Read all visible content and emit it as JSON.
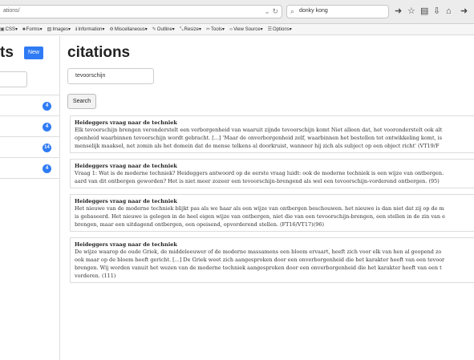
{
  "browser": {
    "url": "ations/",
    "search_text": "donky kong",
    "devbar": [
      {
        "icon": "▣",
        "label": "CSS▾"
      },
      {
        "icon": "■",
        "label": "Forms▾"
      },
      {
        "icon": "▧",
        "label": "Images▾"
      },
      {
        "icon": "ℹ",
        "label": "Information▾"
      },
      {
        "icon": "⚙",
        "label": "Miscellaneous▾"
      },
      {
        "icon": "✎",
        "label": "Outline▾"
      },
      {
        "icon": "⤡",
        "label": "Resize▾"
      },
      {
        "icon": "✂",
        "label": "Tools▾"
      },
      {
        "icon": "‹›",
        "label": "View Source▾"
      },
      {
        "icon": "☰",
        "label": "Options▾"
      }
    ]
  },
  "sidebar": {
    "title": "ts",
    "new_label": "New",
    "items": [
      {
        "count": "4"
      },
      {
        "count": "4"
      },
      {
        "count": "14"
      },
      {
        "count": "4"
      }
    ]
  },
  "main": {
    "title": "citations",
    "query": "tevoorschijn",
    "search_label": "Search"
  },
  "results": [
    {
      "heading": "Heideggers vraag naar de techniek",
      "lines": [
        "Elk tevoorschijn brengen veronderstelt een verborgenheid van waaruit zijnde tevoorschijn komt Niet alleen dat, het vooronderstelt ook alt",
        "openheid waarbinnen tevoorschijn wordt gebracht. [...] 'Maar de onverborgenheid zelf, waarbinnen het bestellen tot ontwikkeling komt, is",
        "menselijk maaksel, net zomin als het domein dat de mense telkens al doorkruist, wanneer hij zich als subject op een object richt' (VT19/F"
      ]
    },
    {
      "heading": "Heideggers vraag naar de techniek",
      "lines": [
        "Vraag 1: Wat is de moderne techniek? Heideggers antwoord op de eerste vraag luidt: ook de moderne techniek is een wijze van ontbergen.",
        "aard van dit ontbergen geworden? Het is niet meer zozeer een tevoorschijn-brengend als wel een tevoorschijn-vorderend ontbergen. (95)"
      ]
    },
    {
      "heading": "Heideggers vraag naar de techniek",
      "lines": [
        "Het nieuwe van de moderne techniek blijkt pas als we haar als een wijze van ontbergen beschouwen. het nieuwe is dan niet dat zij op de m",
        "is gebaseerd. Het nieuwe is gelegen in de heel eigen wijze van ontbergen, niet die van een tevoorschijn-brengen, een stellen in de zin van e",
        "brengen, maar een uitdagend ontbergen, een opeisend, opvorderend stellen. (FT16/VT17)(96)"
      ]
    },
    {
      "heading": "Heideggers vraag naar de techniek",
      "lines": [
        "De wijze waarop de oude Griek, de middeleeuwer of de moderne massamens een bloem ervaart, heeft zich voor elk van hen al geopend zo",
        "ook maar op de bloem heeft gericht. [...] De Griek weet zich aangesproken door een onverborgenheid die het karakter heeft van een tevoor",
        "brengen. Wij worden vanuit het wezen van de moderne techniek aangesproken door een onverborgenheid die het karakter heeft van een t",
        "vorderen. (111)"
      ]
    }
  ]
}
